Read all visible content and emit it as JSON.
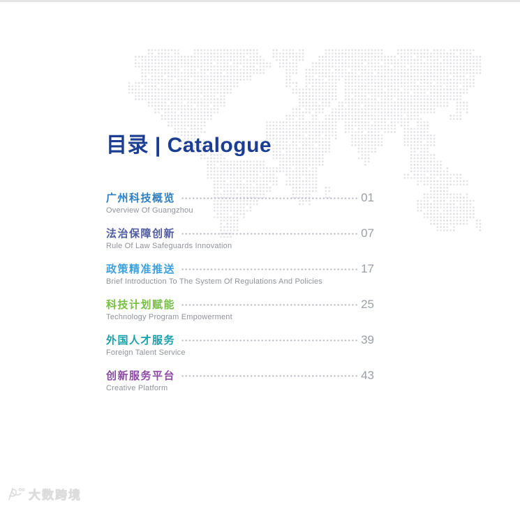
{
  "page": {
    "title": "目录 | Catalogue",
    "watermark_text": "大数跨境"
  },
  "colors": {
    "title": "#1b3e92",
    "leader_dot": "#b9bcc5",
    "page_number": "#9aa0a8",
    "subtitle": "#8f939b",
    "map_dot": "#dedee3",
    "top_strip": "#e3e3e6",
    "watermark": "#dcdcdc"
  },
  "catalogue": {
    "items": [
      {
        "title_zh": "广州科技概览",
        "title_en": "Overview Of Guangzhou",
        "page": "01",
        "color": "#2e7fc2"
      },
      {
        "title_zh": "法治保障创新",
        "title_en": "Rule Of Law Safeguards Innovation",
        "page": "07",
        "color": "#4f5ca0"
      },
      {
        "title_zh": "政策精准推送",
        "title_en": "Brief Introduction To The System Of Regulations And Policies",
        "page": "17",
        "color": "#3ea2dc"
      },
      {
        "title_zh": "科技计划赋能",
        "title_en": "Technology Program Empowerment",
        "page": "25",
        "color": "#76bf41"
      },
      {
        "title_zh": "外国人才服务",
        "title_en": "Foreign Talent Service",
        "page": "39",
        "color": "#16a1aa"
      },
      {
        "title_zh": "创新服务平台",
        "title_en": "Creative Platform",
        "page": "43",
        "color": "#8d4aa5"
      }
    ]
  }
}
